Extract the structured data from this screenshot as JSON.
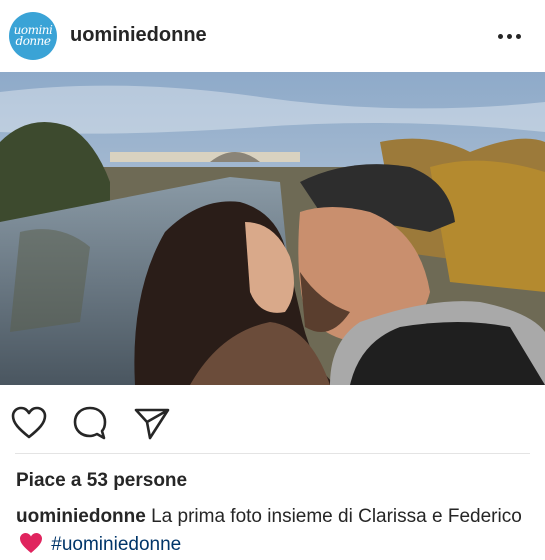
{
  "post": {
    "username": "uominiedonne",
    "avatar_logo": [
      "uomini",
      "donne"
    ],
    "more_icon": "more-horizontal-icon",
    "likes": "Piace a 53 persone",
    "caption": {
      "username": "uominiedonne",
      "text": "La prima foto insieme di Clarissa e Federico",
      "emoji": "red-heart",
      "hashtag": "#uominiedonne"
    },
    "actions": [
      "heart-outline-icon",
      "comment-icon",
      "share-icon"
    ],
    "colors": {
      "text": "#262626",
      "hashtag": "#003569",
      "avatar": "#3aa3d6",
      "heart": "#e0245e"
    }
  }
}
